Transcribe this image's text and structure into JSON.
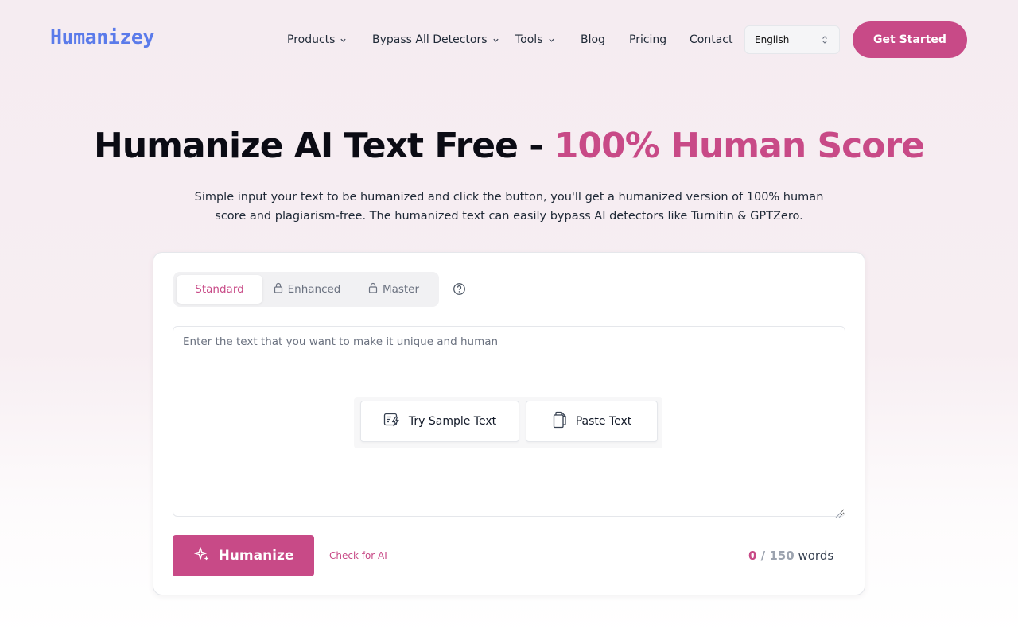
{
  "header": {
    "logo": "Humanizey",
    "nav": [
      {
        "label": "Products",
        "has_dropdown": true
      },
      {
        "label": "Bypass All Detectors",
        "has_dropdown": true
      },
      {
        "label": "Tools",
        "has_dropdown": true
      },
      {
        "label": "Blog",
        "has_dropdown": false
      },
      {
        "label": "Pricing",
        "has_dropdown": false
      },
      {
        "label": "Contact",
        "has_dropdown": false
      }
    ],
    "language": "English",
    "cta": "Get Started"
  },
  "hero": {
    "title_main": "Humanize AI Text Free - ",
    "title_accent": "100% Human Score",
    "subtitle": "Simple input your text to be humanized and click the button, you'll get a humanized version of 100% human score and plagiarism-free. The humanized text can easily bypass AI detectors like Turnitin & GPTZero."
  },
  "editor": {
    "modes": [
      {
        "label": "Standard",
        "locked": false,
        "active": true
      },
      {
        "label": "Enhanced",
        "locked": true,
        "active": false
      },
      {
        "label": "Master",
        "locked": true,
        "active": false
      }
    ],
    "help_icon": "question-circle-icon",
    "input_value": "",
    "placeholder": "Enter the text that you want to make it unique and human",
    "sample_button": "Try Sample Text",
    "paste_button": "Paste Text",
    "humanize_button": "Humanize",
    "check_ai_link": "Check for AI",
    "word_count": {
      "current": "0",
      "separator": " / ",
      "max": "150",
      "unit": "words"
    }
  },
  "colors": {
    "accent": "#c84a87",
    "logo": "#5b7bea",
    "background": "#f5ecf1"
  }
}
